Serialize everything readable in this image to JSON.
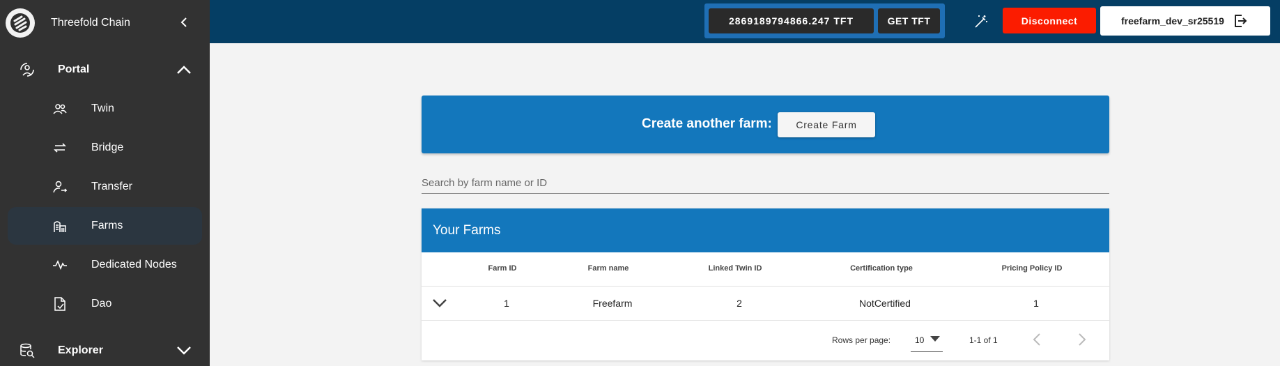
{
  "sidebar": {
    "brand": "Threefold Chain",
    "portal": {
      "label": "Portal",
      "items": [
        {
          "label": "Twin",
          "icon": "twin-icon"
        },
        {
          "label": "Bridge",
          "icon": "bridge-icon"
        },
        {
          "label": "Transfer",
          "icon": "transfer-icon"
        },
        {
          "label": "Farms",
          "icon": "farms-icon",
          "active": true
        },
        {
          "label": "Dedicated Nodes",
          "icon": "dedicated-nodes-icon"
        },
        {
          "label": "Dao",
          "icon": "dao-icon"
        }
      ]
    },
    "explorer": {
      "label": "Explorer"
    }
  },
  "topbar": {
    "balance": "2869189794866.247 TFT",
    "get_tft": "GET TFT",
    "disconnect": "Disconnect",
    "account": "freefarm_dev_sr25519"
  },
  "create": {
    "label": "Create another farm:",
    "button": "Create Farm"
  },
  "search": {
    "placeholder": "Search by farm name or ID"
  },
  "farms": {
    "title": "Your Farms",
    "columns": [
      "Farm ID",
      "Farm name",
      "Linked Twin ID",
      "Certification type",
      "Pricing Policy ID"
    ],
    "rows": [
      [
        "1",
        "Freefarm",
        "2",
        "NotCertified",
        "1"
      ]
    ],
    "footer": {
      "rows_per_page_label": "Rows per page:",
      "rows_per_page": "10",
      "range": "1-1 of 1"
    }
  },
  "colors": {
    "sidebar_bg": "#323232",
    "topbar_bg": "#053e64",
    "accent_blue": "#1377bc",
    "disconnect_red": "#fb1c00"
  }
}
